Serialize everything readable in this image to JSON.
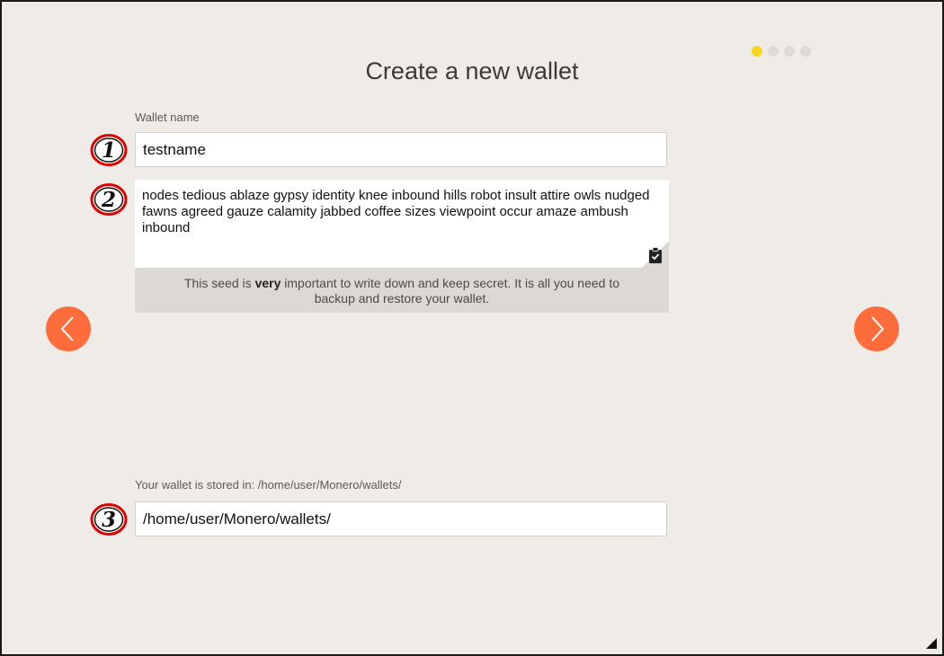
{
  "page": {
    "title": "Create a new wallet"
  },
  "progress": {
    "current_step": 1,
    "total_steps": 4,
    "active_color": "#f6d71e",
    "inactive_color": "#dedad6"
  },
  "wallet_name": {
    "label": "Wallet name",
    "value": "testname"
  },
  "seed": {
    "words": "nodes tedious ablaze gypsy identity knee inbound hills robot insult attire owls nudged fawns agreed gauze calamity jabbed coffee sizes viewpoint occur amaze ambush inbound",
    "note_prefix": "This seed is ",
    "note_emphasis": "very",
    "note_suffix": " important to write down and keep secret. It is all you need to backup and restore your wallet.",
    "copy_icon": "clipboard-check-icon"
  },
  "location": {
    "label": "Your wallet is stored in: /home/user/Monero/wallets/",
    "value": "/home/user/Monero/wallets/"
  },
  "annotations": {
    "marker_1": "1",
    "marker_2": "2",
    "marker_3": "3"
  },
  "navigation": {
    "prev_icon": "chevron-left-icon",
    "next_icon": "chevron-right-icon",
    "button_color": "#ff6c3c"
  }
}
